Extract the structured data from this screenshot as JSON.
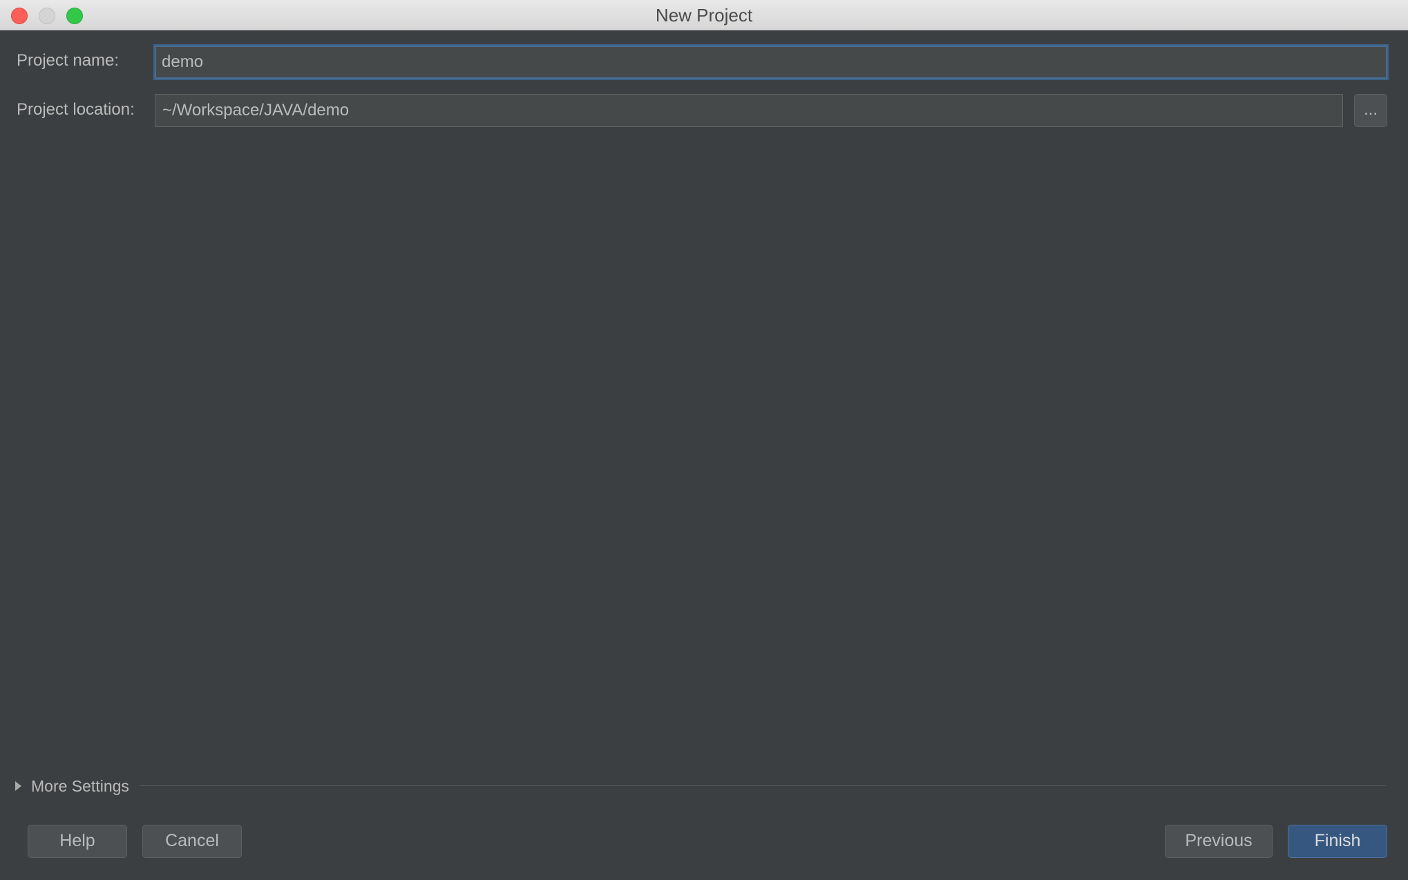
{
  "window": {
    "title": "New Project"
  },
  "form": {
    "project_name_label": "Project name:",
    "project_name_value": "demo",
    "project_location_label": "Project location:",
    "project_location_value": "~/Workspace/JAVA/demo",
    "browse_label": "..."
  },
  "more_settings": {
    "label": "More Settings",
    "expanded": false
  },
  "buttons": {
    "help": "Help",
    "cancel": "Cancel",
    "previous": "Previous",
    "finish": "Finish"
  },
  "colors": {
    "background": "#3c3f41",
    "primary_button": "#365880",
    "focus_border": "#3d6185"
  }
}
